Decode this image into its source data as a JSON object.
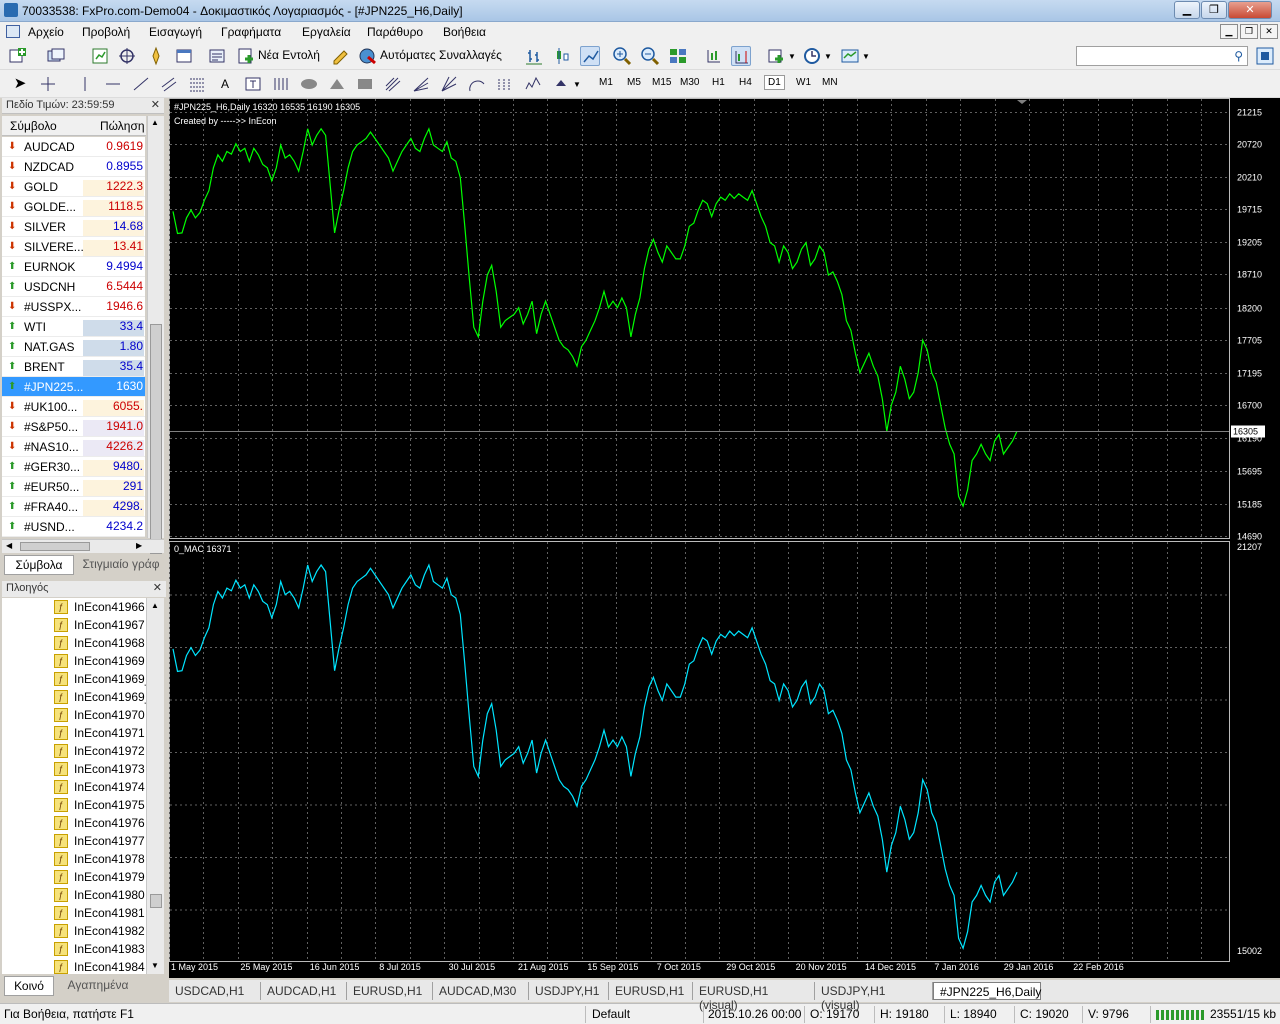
{
  "window": {
    "title": "70033538: FxPro.com-Demo04 - Δοκιμαστικός Λογαριασμός - [#JPN225_H6,Daily]"
  },
  "menu": [
    "Αρχείο",
    "Προβολή",
    "Εισαγωγή",
    "Γραφήματα",
    "Εργαλεία",
    "Παράθυρο",
    "Βοήθεια"
  ],
  "toolbar": {
    "new_order": "Νέα Εντολή",
    "auto_trading": "Αυτόματες Συναλλαγές",
    "timeframes": [
      "M1",
      "M5",
      "M15",
      "M30",
      "H1",
      "H4",
      "D1",
      "W1",
      "MN"
    ],
    "selected_timeframe": "D1",
    "icons": [
      "new-chart-icon",
      "profiles-icon",
      "market-watch-icon",
      "data-window-icon",
      "navigator-icon",
      "terminal-icon",
      "strategy-tester-icon",
      "metaeditor-icon",
      "bar-chart-icon",
      "candlestick-icon",
      "line-chart-icon",
      "zoom-in-icon",
      "zoom-out-icon",
      "tile-windows-icon",
      "auto-scroll-icon",
      "chart-shift-icon",
      "indicators-icon",
      "periods-icon",
      "templates-icon"
    ]
  },
  "market_watch": {
    "header": "Πεδίο Τιμών: 23:59:59",
    "col_symbol": "Σύμβολο",
    "col_bid": "Πώληση",
    "rows": [
      {
        "symbol": "AUDCAD",
        "bid": "0.9619",
        "dir": "down",
        "color": "#cc0000",
        "bg": "#ffffff"
      },
      {
        "symbol": "NZDCAD",
        "bid": "0.8955",
        "dir": "down",
        "color": "#0000cc",
        "bg": "#ffffff"
      },
      {
        "symbol": "GOLD",
        "bid": "1222.3",
        "dir": "down",
        "color": "#cc0000",
        "bg": "#fdf3dd"
      },
      {
        "symbol": "GOLDE...",
        "bid": "1118.5",
        "dir": "down",
        "color": "#cc0000",
        "bg": "#fdf3dd"
      },
      {
        "symbol": "SILVER",
        "bid": "14.68",
        "dir": "down",
        "color": "#0000cc",
        "bg": "#fdf3dd"
      },
      {
        "symbol": "SILVERE...",
        "bid": "13.41",
        "dir": "down",
        "color": "#cc0000",
        "bg": "#fdf3dd"
      },
      {
        "symbol": "EURNOK",
        "bid": "9.4994",
        "dir": "up",
        "color": "#0000cc",
        "bg": "#ffffff"
      },
      {
        "symbol": "USDCNH",
        "bid": "6.5444",
        "dir": "up",
        "color": "#cc0000",
        "bg": "#ffffff"
      },
      {
        "symbol": "#USSPX...",
        "bid": "1946.6",
        "dir": "down",
        "color": "#cc0000",
        "bg": "#ffffff"
      },
      {
        "symbol": "WTI",
        "bid": "33.4",
        "dir": "up",
        "color": "#0000cc",
        "bg": "#cfdcea"
      },
      {
        "symbol": "NAT.GAS",
        "bid": "1.80",
        "dir": "up",
        "color": "#0000cc",
        "bg": "#cfdcea"
      },
      {
        "symbol": "BRENT",
        "bid": "35.4",
        "dir": "up",
        "color": "#0000cc",
        "bg": "#cfdcea"
      },
      {
        "symbol": "#JPN225...",
        "bid": "1630",
        "dir": "up",
        "color": "#ffffff",
        "bg": "#3399ff",
        "selected": true
      },
      {
        "symbol": "#UK100...",
        "bid": "6055.",
        "dir": "down",
        "color": "#cc0000",
        "bg": "#fdf3dd"
      },
      {
        "symbol": "#S&P50...",
        "bid": "1941.0",
        "dir": "down",
        "color": "#cc0000",
        "bg": "#ebe9f5"
      },
      {
        "symbol": "#NAS10...",
        "bid": "4226.2",
        "dir": "down",
        "color": "#cc0000",
        "bg": "#ebe9f5"
      },
      {
        "symbol": "#GER30...",
        "bid": "9480.",
        "dir": "up",
        "color": "#0000cc",
        "bg": "#fdf3dd"
      },
      {
        "symbol": "#EUR50...",
        "bid": "291",
        "dir": "up",
        "color": "#0000cc",
        "bg": "#fdf3dd"
      },
      {
        "symbol": "#FRA40...",
        "bid": "4298.",
        "dir": "up",
        "color": "#0000cc",
        "bg": "#fdf3dd"
      },
      {
        "symbol": "#USND...",
        "bid": "4234.2",
        "dir": "up",
        "color": "#0000cc",
        "bg": "#ffffff"
      }
    ],
    "tabs": [
      "Σύμβολα",
      "Στιγμιαίο γράφ"
    ]
  },
  "navigator": {
    "header": "Πλοηγός",
    "items": [
      "InEcon41966",
      "InEcon41967",
      "InEcon41968",
      "InEcon41969",
      "InEcon41969_",
      "InEcon41969_",
      "InEcon41970",
      "InEcon41971",
      "InEcon41972",
      "InEcon41973",
      "InEcon41974",
      "InEcon41975",
      "InEcon41976",
      "InEcon41977",
      "InEcon41978",
      "InEcon41979",
      "InEcon41980",
      "InEcon41981",
      "InEcon41982",
      "InEcon41983",
      "InEcon41984"
    ],
    "tabs": [
      "Κοινό",
      "Αγαπημένα"
    ]
  },
  "chart": {
    "header": "#JPN225_H6,Daily  16320 16535 16190 16305",
    "created_by": "Created by  ----->> InEcon",
    "indicator_label": "0_MAC 16371",
    "current_price": "16305",
    "price_color": "#00ff00",
    "indicator_color": "#00e5ff"
  },
  "chart_tabs": [
    "USDCAD,H1",
    "AUDCAD,H1",
    "EURUSD,H1",
    "AUDCAD,M30",
    "USDJPY,H1",
    "EURUSD,H1",
    "EURUSD,H1 (visual)",
    "USDJPY,H1 (visual)",
    "#JPN225_H6,Daily"
  ],
  "active_chart_tab": "#JPN225_H6,Daily",
  "status": {
    "help": "Για Βοήθεια, πατήστε F1",
    "profile": "Default",
    "datetime": "2015.10.26 00:00",
    "open": "O: 19170",
    "high": "H: 19180",
    "low": "L: 18940",
    "close": "C: 19020",
    "volume": "V: 9796",
    "traffic": "23551/15 kb"
  },
  "chart_data": [
    {
      "type": "line",
      "title": "#JPN225_H6,Daily",
      "series": [
        {
          "values": [
            19680,
            19340,
            19350,
            19580,
            19700,
            19580,
            19660,
            19850,
            20000,
            20350,
            20550,
            20450,
            20600,
            20560,
            20720,
            20600,
            20650,
            20450,
            20650,
            20550,
            20400,
            20350,
            20150,
            20350,
            20700,
            20500,
            20550,
            20450,
            20300,
            20600,
            20950,
            20700,
            20850,
            20950,
            20850,
            20100,
            19350,
            19700,
            20000,
            20350,
            20600,
            20700,
            20750,
            20800,
            20900,
            20800,
            20700,
            20600,
            20500,
            20300,
            20450,
            20600,
            20700,
            20800,
            20650,
            20600,
            20800,
            20950,
            20700,
            20650,
            20600,
            20750,
            20500,
            20450,
            20200,
            19450,
            18650,
            17900,
            17750,
            18300,
            18700,
            18850,
            18450,
            17900,
            18000,
            18050,
            18100,
            18200,
            17950,
            18100,
            18300,
            17800,
            18100,
            18300,
            18100,
            17900,
            17700,
            17600,
            17550,
            17450,
            17300,
            17600,
            17700,
            17850,
            18000,
            18200,
            18450,
            18200,
            18300,
            18200,
            18350,
            18200,
            17750,
            18100,
            18350,
            18800,
            19100,
            19250,
            19050,
            18900,
            19150,
            19050,
            18950,
            18950,
            19150,
            19450,
            19500,
            19700,
            19850,
            19800,
            19600,
            19800,
            19900,
            19850,
            19950,
            19880,
            19950,
            19900,
            19850,
            20000,
            19800,
            19600,
            19450,
            19200,
            19150,
            18900,
            19150,
            19050,
            18800,
            18900,
            19100,
            19200,
            18850,
            18950,
            19150,
            19050,
            18700,
            18750,
            18600,
            18400,
            18000,
            17850,
            17500,
            17200,
            17350,
            17500,
            17300,
            17150,
            16800,
            16300,
            16700,
            16900,
            17300,
            17100,
            16800,
            16900,
            17200,
            17700,
            17550,
            17200,
            17050,
            16700,
            16350,
            16100,
            15950,
            15300,
            15150,
            15400,
            15850,
            15950,
            16100,
            15950,
            15850,
            16150,
            16250,
            15950,
            16050,
            16150,
            16300
          ]
        }
      ],
      "ylim": [
        14690,
        21300
      ],
      "y_ticks": [
        "21215",
        "20720",
        "20210",
        "19715",
        "19205",
        "18710",
        "18200",
        "17705",
        "17195",
        "16700",
        "16190",
        "15695",
        "15185",
        "14690"
      ],
      "x_ticks": [
        "1 May 2015",
        "25 May 2015",
        "16 Jun 2015",
        "8 Jul 2015",
        "30 Jul 2015",
        "21 Aug 2015",
        "15 Sep 2015",
        "7 Oct 2015",
        "29 Oct 2015",
        "20 Nov 2015",
        "14 Dec 2015",
        "7 Jan 2016",
        "29 Jan 2016",
        "22 Feb 2016"
      ],
      "current_value": 16305,
      "grid": true
    },
    {
      "type": "line",
      "title": "0_MAC 16371",
      "series": [
        {
          "values": [
            19680,
            19340,
            19350,
            19580,
            19700,
            19580,
            19660,
            19850,
            20000,
            20350,
            20550,
            20450,
            20600,
            20560,
            20720,
            20600,
            20650,
            20450,
            20650,
            20550,
            20400,
            20350,
            20150,
            20350,
            20700,
            20500,
            20550,
            20450,
            20300,
            20600,
            20950,
            20700,
            20850,
            20950,
            20850,
            20100,
            19350,
            19700,
            20000,
            20350,
            20600,
            20700,
            20750,
            20800,
            20900,
            20800,
            20700,
            20600,
            20500,
            20300,
            20450,
            20600,
            20700,
            20800,
            20650,
            20600,
            20800,
            20950,
            20700,
            20650,
            20600,
            20750,
            20500,
            20450,
            20200,
            19450,
            18650,
            17900,
            17750,
            18300,
            18700,
            18850,
            18450,
            17900,
            18000,
            18050,
            18100,
            18200,
            17950,
            18100,
            18300,
            17800,
            18100,
            18300,
            18100,
            17900,
            17700,
            17600,
            17550,
            17450,
            17300,
            17600,
            17700,
            17850,
            18000,
            18200,
            18450,
            18200,
            18300,
            18200,
            18350,
            18200,
            17750,
            18100,
            18350,
            18800,
            19100,
            19250,
            19050,
            18900,
            19150,
            19050,
            18950,
            18950,
            19150,
            19450,
            19500,
            19700,
            19850,
            19800,
            19600,
            19800,
            19900,
            19850,
            19950,
            19880,
            19950,
            19900,
            19850,
            20000,
            19800,
            19600,
            19450,
            19200,
            19150,
            18900,
            19150,
            19050,
            18800,
            18900,
            19100,
            19200,
            18850,
            18950,
            19150,
            19050,
            18700,
            18750,
            18600,
            18400,
            18000,
            17850,
            17500,
            17200,
            17350,
            17500,
            17300,
            17150,
            16800,
            16300,
            16700,
            16900,
            17300,
            17100,
            16800,
            16900,
            17200,
            17700,
            17550,
            17200,
            17050,
            16700,
            16350,
            16100,
            15950,
            15300,
            15150,
            15400,
            15850,
            15950,
            16100,
            15950,
            15850,
            16150,
            16250,
            15950,
            16050,
            16150,
            16300
          ]
        }
      ],
      "ylim": [
        15002,
        21207
      ],
      "y_ticks": [
        "21207",
        "15002"
      ],
      "grid": true
    }
  ]
}
